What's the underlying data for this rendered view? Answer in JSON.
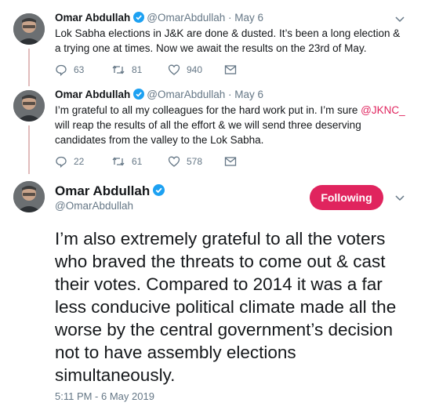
{
  "tweets": [
    {
      "name": "Omar Abdullah",
      "handle": "@OmarAbdullah",
      "date": "· May 6",
      "text": "Lok Sabha elections in J&K are done & dusted. It’s been a long election & a trying one at times. Now we await the results on the 23rd of May.",
      "replies": "63",
      "retweets": "81",
      "likes": "940"
    },
    {
      "name": "Omar Abdullah",
      "handle": "@OmarAbdullah",
      "date": "· May 6",
      "text_before": "I’m grateful to all my colleagues for the hard work put in. I’m sure ",
      "mention": "@JKNC_",
      "text_after": " will reap the results of all the effort & we will send three deserving candidates from the valley to the Lok Sabha.",
      "replies": "22",
      "retweets": "61",
      "likes": "578"
    }
  ],
  "main_tweet": {
    "name": "Omar Abdullah",
    "handle": "@OmarAbdullah",
    "follow_label": "Following",
    "text": "I’m also extremely grateful to all the voters who braved the threats to come out & cast their votes. Compared to 2014 it was a far less conducive political climate made all the worse by the central government’s decision not to have assembly elections simultaneously.",
    "timestamp": "5:11 PM - 6 May 2019"
  },
  "colors": {
    "verified": "#1da1f2",
    "follow_button": "#e0245e",
    "mention": "#e0245e",
    "muted": "#657786",
    "thread_line": "#e1bcbc"
  },
  "icons": [
    "verified-badge-icon",
    "chevron-down-icon",
    "reply-icon",
    "retweet-icon",
    "like-icon",
    "message-icon"
  ]
}
